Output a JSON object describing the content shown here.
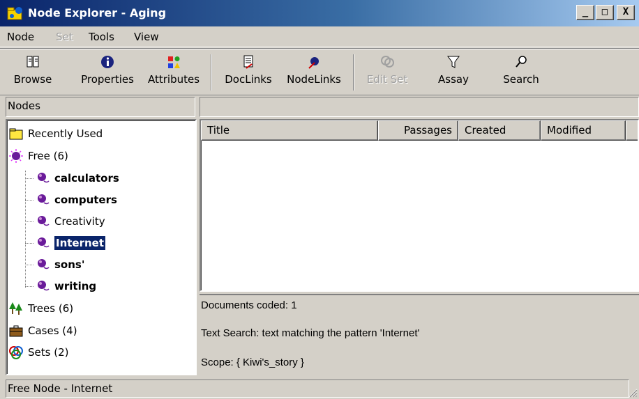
{
  "window": {
    "title": "Node Explorer - Aging",
    "controls": {
      "minimize": "_",
      "maximize": "□",
      "close": "X"
    }
  },
  "menu": {
    "items": [
      {
        "label": "Node",
        "enabled": true
      },
      {
        "label": "Set",
        "enabled": false
      },
      {
        "label": "Tools",
        "enabled": true
      },
      {
        "label": "View",
        "enabled": true
      }
    ]
  },
  "toolbar": {
    "browse": "Browse",
    "properties": "Properties",
    "attributes": "Attributes",
    "doclinks": "DocLinks",
    "nodelinks": "NodeLinks",
    "edit_set": "Edit Set",
    "assay": "Assay",
    "search": "Search"
  },
  "nodes_pane": {
    "header": "Nodes",
    "tree": {
      "recently_used": "Recently Used",
      "free": "Free (6)",
      "children": [
        "calculators",
        "computers",
        "Creativity",
        "Internet",
        "sons'",
        "writing"
      ],
      "trees": "Trees (6)",
      "cases": "Cases (4)",
      "sets": "Sets (2)"
    }
  },
  "list": {
    "columns": [
      "Title",
      "Passages",
      "Created",
      "Modified"
    ]
  },
  "info": {
    "documents_coded": "Documents coded: 1",
    "text_search": "Text Search: text matching the pattern 'Internet'",
    "scope": "Scope: { Kiwi's_story }"
  },
  "status": {
    "text": "Free Node - Internet"
  },
  "colors": {
    "titlebar_start": "#0a246a",
    "titlebar_end": "#a6caf0",
    "selection": "#0a246a",
    "face": "#d4d0c8"
  }
}
